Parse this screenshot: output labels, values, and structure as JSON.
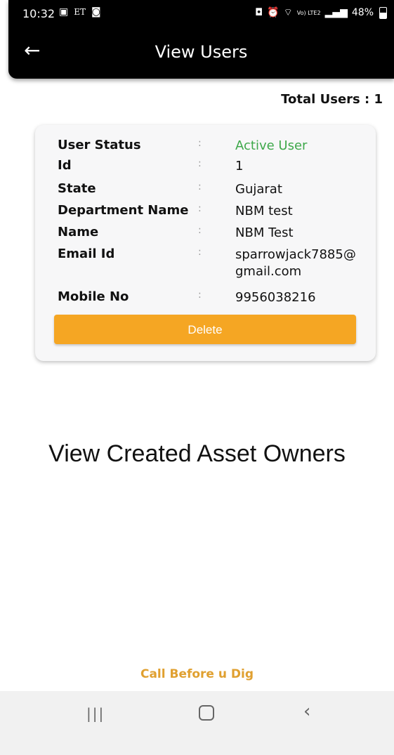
{
  "status_bar": {
    "time": "10:32",
    "left_icons": [
      "gallery-icon",
      "et-icon",
      "image-icon"
    ],
    "right_icons": [
      "lock-icon",
      "alarm-icon",
      "wifi-icon",
      "signal-icon"
    ],
    "network_label": "Vo) LTE2",
    "battery": "48%"
  },
  "header": {
    "title": "View Users",
    "back_icon": "arrow-left-icon"
  },
  "summary": {
    "total_users": "Total Users : 1"
  },
  "user_card": {
    "colon": ":",
    "fields": [
      {
        "label": "User Status",
        "value": "Active User"
      },
      {
        "label": "Id",
        "value": "1"
      },
      {
        "label": "State",
        "value": "Gujarat"
      },
      {
        "label": "Department Name",
        "value": "NBM test"
      },
      {
        "label": "Name",
        "value": "NBM Test"
      },
      {
        "label": "Email Id",
        "value": "sparrowjack7885@gmail.com"
      },
      {
        "label": "Mobile No",
        "value": "9956038216"
      }
    ],
    "delete_label": "Delete",
    "active_color": "#3ea84a",
    "button_color": "#f5a623"
  },
  "main": {
    "view_asset_owners": "View Created Asset Owners"
  },
  "footer": {
    "link_label": "Call Before u Dig",
    "link_color": "#e0a030"
  },
  "nav": {
    "recents_icon": "recents-icon",
    "home_icon": "home-icon",
    "back_icon": "back-icon"
  }
}
